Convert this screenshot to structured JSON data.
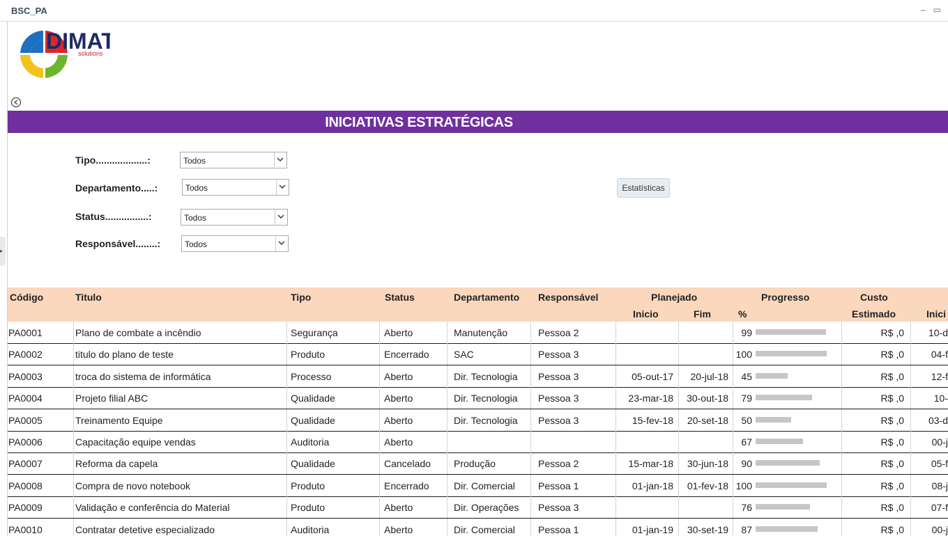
{
  "window": {
    "title": "BSC_PA",
    "controls": "– ▭"
  },
  "logo": {
    "name": "DIMAT",
    "sub": "solutions"
  },
  "banner": {
    "title": "INICIATIVAS ESTRATÉGICAS"
  },
  "filters": {
    "tipo": {
      "label": "Tipo...................:",
      "value": "Todos"
    },
    "departamento": {
      "label": "Departamento.....:",
      "value": "Todos"
    },
    "status": {
      "label": "Status................:",
      "value": "Todos"
    },
    "responsavel": {
      "label": "Responsável........:",
      "value": "Todos"
    }
  },
  "stats_button": "Estatísticas",
  "table": {
    "headers": {
      "codigo": "Código",
      "titulo": "Titulo",
      "tipo": "Tipo",
      "status": "Status",
      "departamento": "Departamento",
      "responsavel": "Responsável",
      "planejado": "Planejado",
      "inicio": "Inicio",
      "fim": "Fim",
      "progresso": "Progresso",
      "pct": "%",
      "custo": "Custo",
      "estimado": "Estimado",
      "inicio_real": "Inici"
    },
    "rows": [
      {
        "codigo": "PA0001",
        "titulo": "Plano de combate a incêndio",
        "tipo": "Segurança",
        "status": "Aberto",
        "departamento": "Manutenção",
        "responsavel": "Pessoa 2",
        "inicio": "",
        "fim": "",
        "pct": "99",
        "progress": 99,
        "custo": "R$ ,0",
        "inicio_real": "10-d"
      },
      {
        "codigo": "PA0002",
        "titulo": "titulo do plano de teste",
        "tipo": "Produto",
        "status": "Encerrado",
        "departamento": "SAC",
        "responsavel": "Pessoa 3",
        "inicio": "",
        "fim": "",
        "pct": "100",
        "progress": 100,
        "custo": "R$ ,0",
        "inicio_real": "04-f"
      },
      {
        "codigo": "PA0003",
        "titulo": "troca do sistema de informática",
        "tipo": "Processo",
        "status": "Aberto",
        "departamento": "Dir. Tecnologia",
        "responsavel": "Pessoa 3",
        "inicio": "05-out-17",
        "fim": "20-jul-18",
        "pct": "45",
        "progress": 45,
        "custo": "R$ ,0",
        "inicio_real": "12-f"
      },
      {
        "codigo": "PA0004",
        "titulo": "Projeto filial ABC",
        "tipo": "Qualidade",
        "status": "Aberto",
        "departamento": "Dir. Tecnologia",
        "responsavel": "Pessoa 3",
        "inicio": "23-mar-18",
        "fim": "30-out-18",
        "pct": "79",
        "progress": 79,
        "custo": "R$ ,0",
        "inicio_real": "10-"
      },
      {
        "codigo": "PA0005",
        "titulo": "Treinamento Equipe",
        "tipo": "Qualidade",
        "status": "Aberto",
        "departamento": "Dir. Tecnologia",
        "responsavel": "Pessoa 3",
        "inicio": "15-fev-18",
        "fim": "20-set-18",
        "pct": "50",
        "progress": 50,
        "custo": "R$ ,0",
        "inicio_real": "03-d"
      },
      {
        "codigo": "PA0006",
        "titulo": "Capacitação equipe vendas",
        "tipo": "Auditoria",
        "status": "Aberto",
        "departamento": "",
        "responsavel": "",
        "inicio": "",
        "fim": "",
        "pct": "67",
        "progress": 67,
        "custo": "R$ ,0",
        "inicio_real": "00-j"
      },
      {
        "codigo": "PA0007",
        "titulo": "Reforma da capela",
        "tipo": "Qualidade",
        "status": "Cancelado",
        "departamento": "Produção",
        "responsavel": "Pessoa 2",
        "inicio": "15-mar-18",
        "fim": "30-jun-18",
        "pct": "90",
        "progress": 90,
        "custo": "R$ ,0",
        "inicio_real": "05-f"
      },
      {
        "codigo": "PA0008",
        "titulo": "Compra de novo notebook",
        "tipo": "Produto",
        "status": "Encerrado",
        "departamento": "Dir. Comercial",
        "responsavel": "Pessoa 1",
        "inicio": "01-jan-18",
        "fim": "01-fev-18",
        "pct": "100",
        "progress": 100,
        "custo": "R$ ,0",
        "inicio_real": "08-j"
      },
      {
        "codigo": "PA0009",
        "titulo": "Validação e conferência do Material",
        "tipo": "Produto",
        "status": "Aberto",
        "departamento": "Dir. Operações",
        "responsavel": "Pessoa 3",
        "inicio": "",
        "fim": "",
        "pct": "76",
        "progress": 76,
        "custo": "R$ ,0",
        "inicio_real": "07-f"
      },
      {
        "codigo": "PA0010",
        "titulo": "Contratar detetive especializado",
        "tipo": "Auditoria",
        "status": "Aberto",
        "departamento": "Dir. Comercial",
        "responsavel": "Pessoa 1",
        "inicio": "01-jan-19",
        "fim": "30-set-19",
        "pct": "87",
        "progress": 87,
        "custo": "R$ ,0",
        "inicio_real": "00-j"
      }
    ]
  },
  "colors": {
    "banner": "#7030a0",
    "header": "#fad7bd",
    "progress": "#c6c6c6"
  }
}
